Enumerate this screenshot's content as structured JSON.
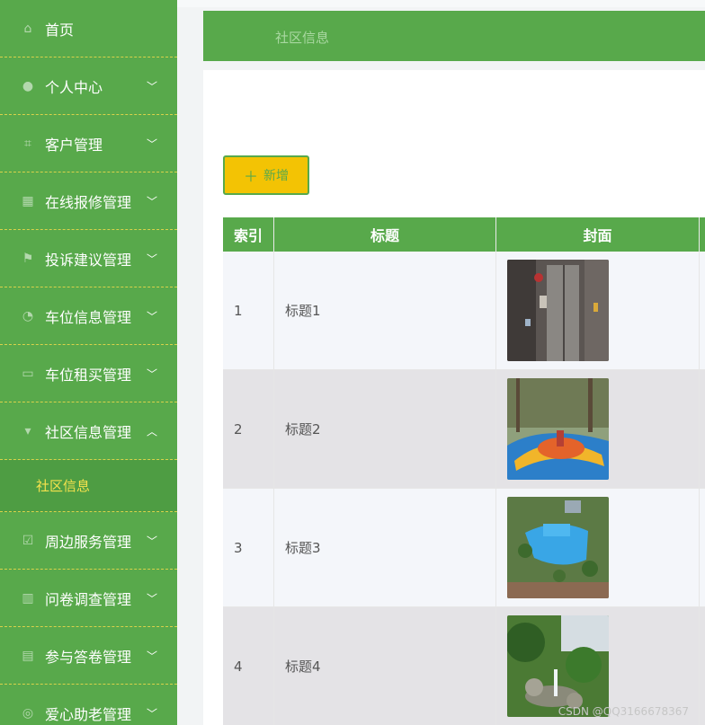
{
  "sidebar": {
    "items": [
      {
        "label": "首页",
        "icon": "home-icon",
        "has_chevron": false
      },
      {
        "label": "个人中心",
        "icon": "user-icon",
        "has_chevron": true
      },
      {
        "label": "客户管理",
        "icon": "crop-icon",
        "has_chevron": true
      },
      {
        "label": "在线报修管理",
        "icon": "grid-icon",
        "has_chevron": true
      },
      {
        "label": "投诉建议管理",
        "icon": "flag-icon",
        "has_chevron": true
      },
      {
        "label": "车位信息管理",
        "icon": "gauge-icon",
        "has_chevron": true
      },
      {
        "label": "车位租买管理",
        "icon": "chat-icon",
        "has_chevron": true
      },
      {
        "label": "社区信息管理",
        "icon": "cup-icon",
        "has_chevron": true,
        "expanded": true
      },
      {
        "label": "周边服务管理",
        "icon": "checkbox-icon",
        "has_chevron": true
      },
      {
        "label": "问卷调查管理",
        "icon": "bar-chart-icon",
        "has_chevron": true
      },
      {
        "label": "参与答卷管理",
        "icon": "clipboard-icon",
        "has_chevron": true
      },
      {
        "label": "爱心助老管理",
        "icon": "heart-icon",
        "has_chevron": true
      }
    ],
    "submenu_label": "社区信息"
  },
  "header": {
    "title": "社区信息"
  },
  "toolbar": {
    "add_label": "新增"
  },
  "table": {
    "columns": [
      "索引",
      "标题",
      "封面"
    ],
    "rows": [
      {
        "index": "1",
        "title": "标题1",
        "cover": "elevator"
      },
      {
        "index": "2",
        "title": "标题2",
        "cover": "playground"
      },
      {
        "index": "3",
        "title": "标题3",
        "cover": "pool"
      },
      {
        "index": "4",
        "title": "标题4",
        "cover": "garden"
      }
    ]
  },
  "watermark": "CSDN @QQ3166678367",
  "colors": {
    "accent": "#58a94b",
    "button": "#f3c304",
    "active_sub": "#f5e24d"
  }
}
